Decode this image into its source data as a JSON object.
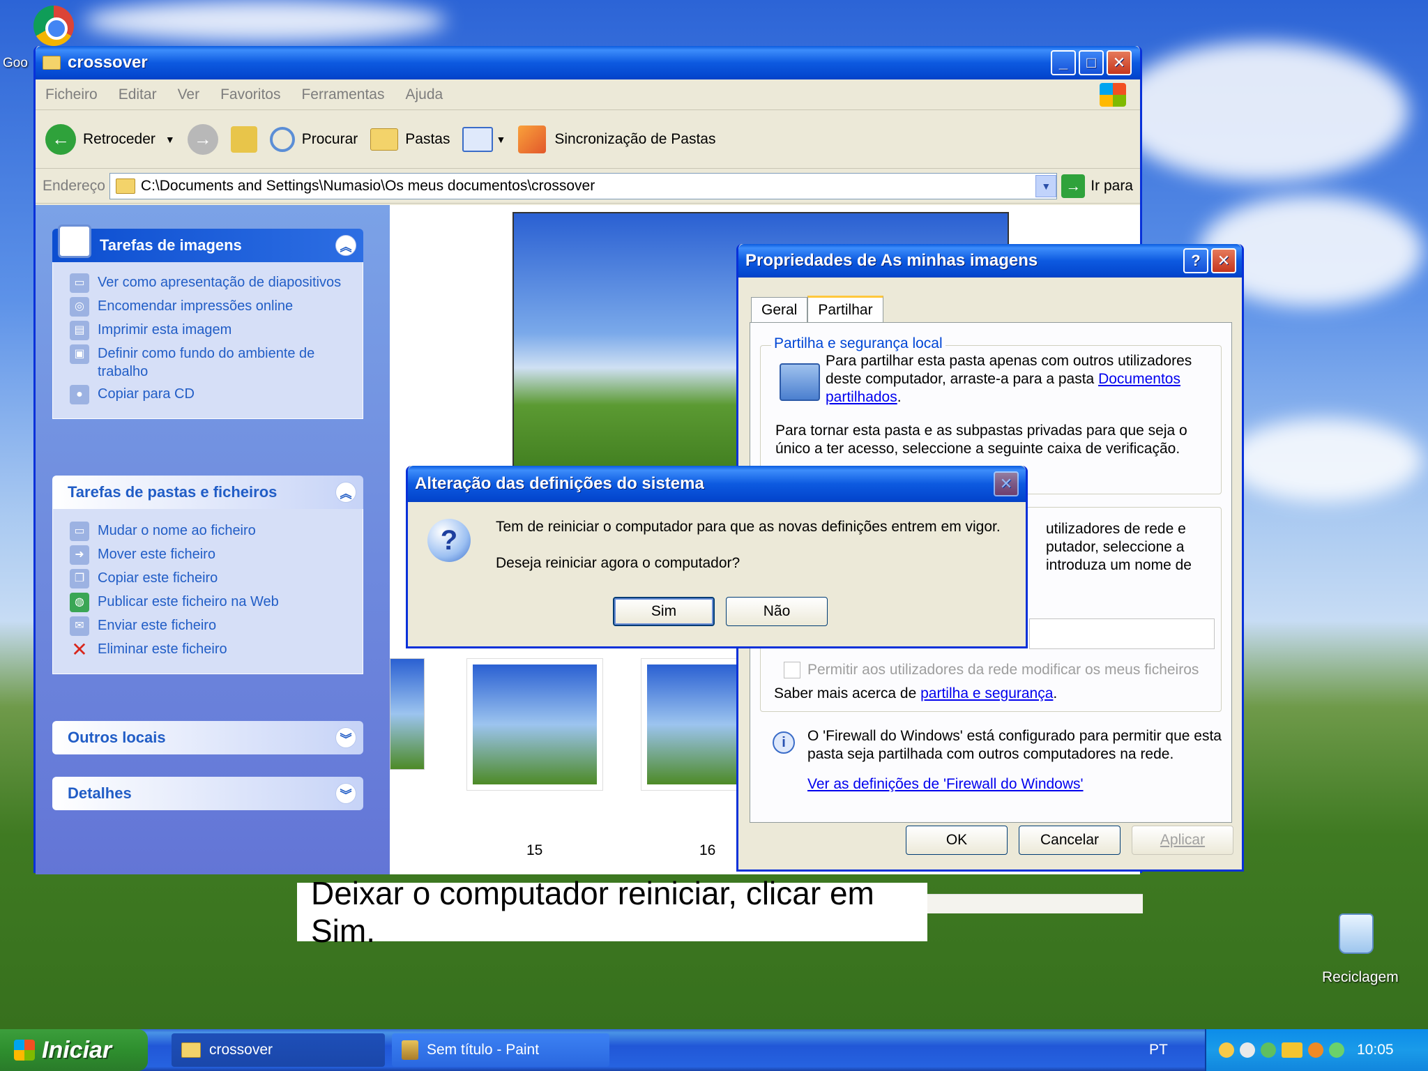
{
  "desktop": {
    "chrome_label": "Goo",
    "recycle_label": "Reciclagem"
  },
  "explorer": {
    "title": "crossover",
    "menu": [
      "Ficheiro",
      "Editar",
      "Ver",
      "Favoritos",
      "Ferramentas",
      "Ajuda"
    ],
    "toolbar": {
      "back": "Retroceder",
      "search": "Procurar",
      "folders": "Pastas",
      "sync": "Sincronização de Pastas"
    },
    "address": {
      "label": "Endereço",
      "path": "C:\\Documents and Settings\\Numasio\\Os meus documentos\\crossover",
      "go": "Ir para"
    },
    "image_tasks": {
      "title": "Tarefas de imagens",
      "items": [
        "Ver como apresentação de diapositivos",
        "Encomendar impressões online",
        "Imprimir esta imagem",
        "Definir como fundo do ambiente de trabalho",
        "Copiar para CD"
      ]
    },
    "file_tasks": {
      "title": "Tarefas de pastas e ficheiros",
      "items": [
        "Mudar o nome ao ficheiro",
        "Mover este ficheiro",
        "Copiar este ficheiro",
        "Publicar este ficheiro na Web",
        "Enviar este ficheiro",
        "Eliminar este ficheiro"
      ]
    },
    "other_places": "Outros locais",
    "details": "Detalhes",
    "thumbs": [
      "15",
      "16"
    ]
  },
  "props": {
    "title": "Propriedades de As minhas imagens",
    "tabs": [
      "Geral",
      "Partilhar"
    ],
    "local_title": "Partilha e segurança local",
    "local_text1": "Para partilhar esta pasta apenas com outros utilizadores deste computador, arraste-a para a pasta",
    "local_link": "Documentos partilhados",
    "local_text2": "Para tornar esta pasta e as subpastas privadas para que seja o único a ter acesso, seleccione a seguinte caixa de verificação.",
    "net_line1": "utilizadores de rede e",
    "net_line2": "putador, seleccione a",
    "net_line3": "introduza um nome de",
    "allow_modify": "Permitir aos utilizadores da rede modificar os meus ficheiros",
    "learn_more": "Saber mais acerca de",
    "learn_link": "partilha e segurança",
    "firewall_text": "O 'Firewall do Windows' está configurado para permitir que esta pasta seja partilhada com outros computadores na rede.",
    "firewall_link": "Ver as definições de 'Firewall do Windows'",
    "ok": "OK",
    "cancel": "Cancelar",
    "apply": "Aplicar"
  },
  "alert": {
    "title": "Alteração das definições do sistema",
    "line1": "Tem de reiniciar o computador para que as novas definições entrem em vigor.",
    "line2": "Deseja reiniciar agora o computador?",
    "yes": "Sim",
    "no": "Não"
  },
  "caption": "Deixar o computador reiniciar, clicar em Sim.",
  "taskbar": {
    "start": "Iniciar",
    "tasks": [
      "crossover",
      "Sem título - Paint"
    ],
    "lang": "PT",
    "clock": "10:05"
  }
}
